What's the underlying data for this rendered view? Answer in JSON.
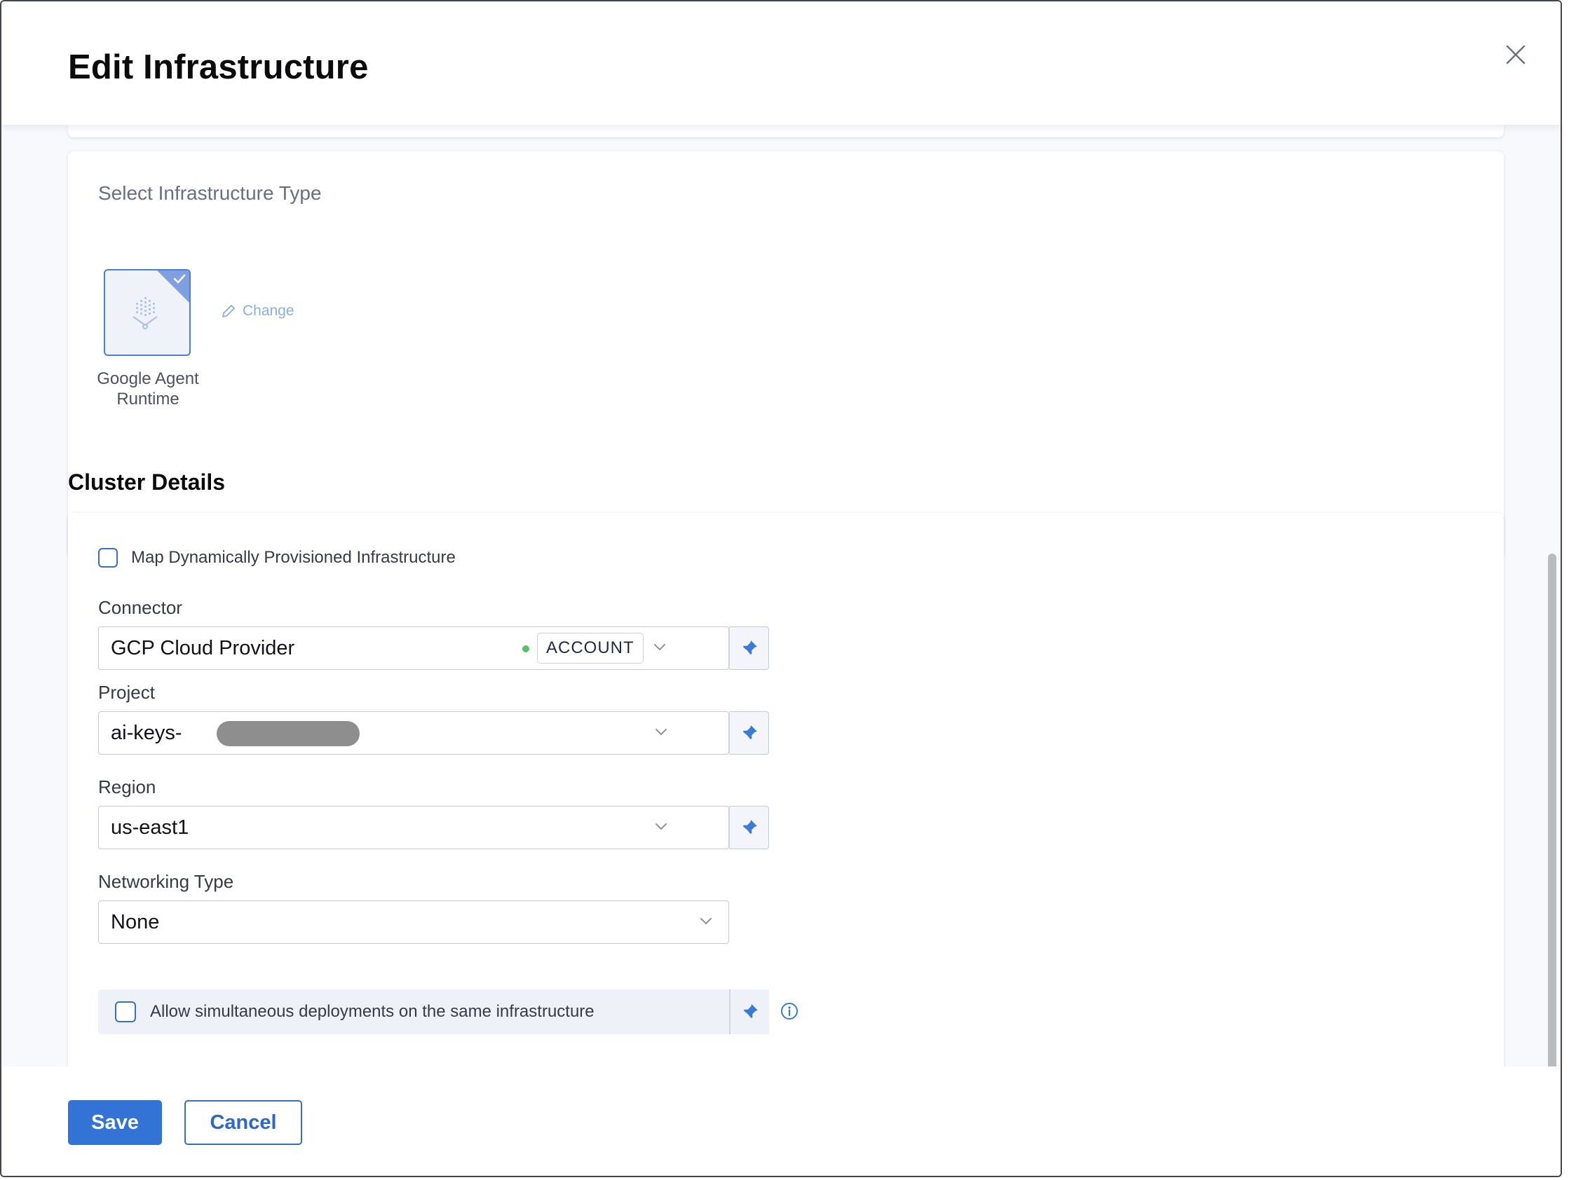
{
  "dialog": {
    "title": "Edit Infrastructure",
    "close_icon": "close-icon"
  },
  "infra_type": {
    "section_label": "Select Infrastructure Type",
    "selected_tile_label": "Google Agent Runtime",
    "selected_tile_icon": "google-agent-runtime-icon",
    "change_label": "Change",
    "change_icon": "pencil-icon"
  },
  "cluster": {
    "heading": "Cluster Details",
    "map_dynamic_label": "Map Dynamically Provisioned Infrastructure",
    "map_dynamic_checked": false,
    "connector": {
      "label": "Connector",
      "value": "GCP Cloud Provider",
      "status": "connected",
      "status_color": "#55c26a",
      "scope": "ACCOUNT"
    },
    "project": {
      "label": "Project",
      "value": "ai-keys-"
    },
    "region": {
      "label": "Region",
      "value": "us-east1"
    },
    "networking": {
      "label": "Networking Type",
      "value": "None"
    },
    "allow_simultaneous": {
      "label": "Allow simultaneous deployments on the same infrastructure",
      "checked": false
    }
  },
  "footer": {
    "save_label": "Save",
    "cancel_label": "Cancel"
  },
  "colors": {
    "accent": "#3373d6",
    "pin": "#3b7bd4",
    "surface": "#f7f9fd"
  }
}
